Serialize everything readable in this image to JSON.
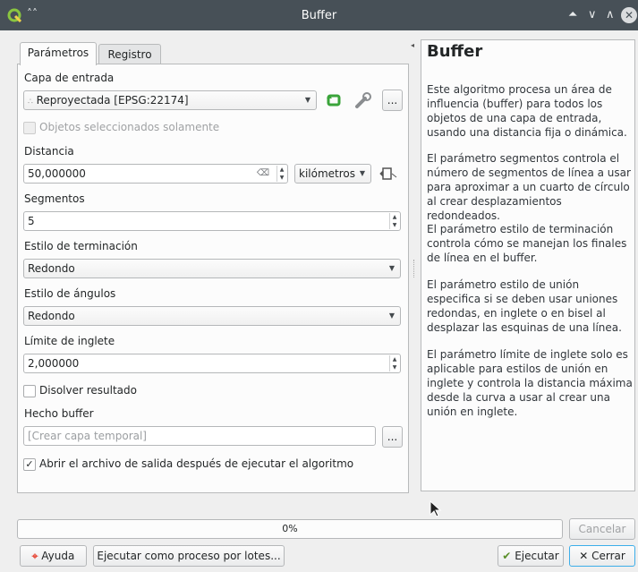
{
  "window": {
    "title": "Buffer"
  },
  "tabs": {
    "params": "Parámetros",
    "log": "Registro"
  },
  "input_layer": {
    "label": "Capa de entrada",
    "value": "Reproyectada [EPSG:22174]"
  },
  "selected_only": {
    "label": "Objetos seleccionados solamente"
  },
  "distance": {
    "label": "Distancia",
    "value": "50,000000",
    "unit": "kilómetros"
  },
  "segments": {
    "label": "Segmentos",
    "value": "5"
  },
  "end_cap": {
    "label": "Estilo de terminación",
    "value": "Redondo"
  },
  "join": {
    "label": "Estilo de ángulos",
    "value": "Redondo"
  },
  "miter": {
    "label": "Límite de inglete",
    "value": "2,000000"
  },
  "dissolve": {
    "label": "Disolver resultado"
  },
  "output": {
    "label": "Hecho buffer",
    "placeholder": "[Crear capa temporal]"
  },
  "open_output": {
    "label": "Abrir el archivo de salida después de ejecutar el algoritmo"
  },
  "help": {
    "title": "Buffer",
    "p1": "Este algoritmo procesa un área de influencia (buffer) para todos los objetos de una capa de entrada, usando una distancia fija o dinámica.",
    "p2": "El parámetro segmentos controla el número de segmentos de línea a usar para aproximar a un cuarto de círculo al crear desplazamientos redondeados.",
    "p3": "El parámetro estilo de terminación controla cómo se manejan los finales de línea en el buffer.",
    "p4": "El parámetro estilo de unión especifica si se deben usar uniones redondas, en inglete o en bisel al desplazar las esquinas de una línea.",
    "p5": "El parámetro límite de inglete solo es aplicable para estilos de unión en inglete y controla la distancia máxima desde la curva a usar al crear una unión en inglete."
  },
  "progress": {
    "text": "0%",
    "value": 0
  },
  "buttons": {
    "cancel": "Cancelar",
    "help": "Ayuda",
    "batch": "Ejecutar como proceso por lotes...",
    "run": "Ejecutar",
    "close": "Cerrar",
    "ellipsis": "..."
  }
}
